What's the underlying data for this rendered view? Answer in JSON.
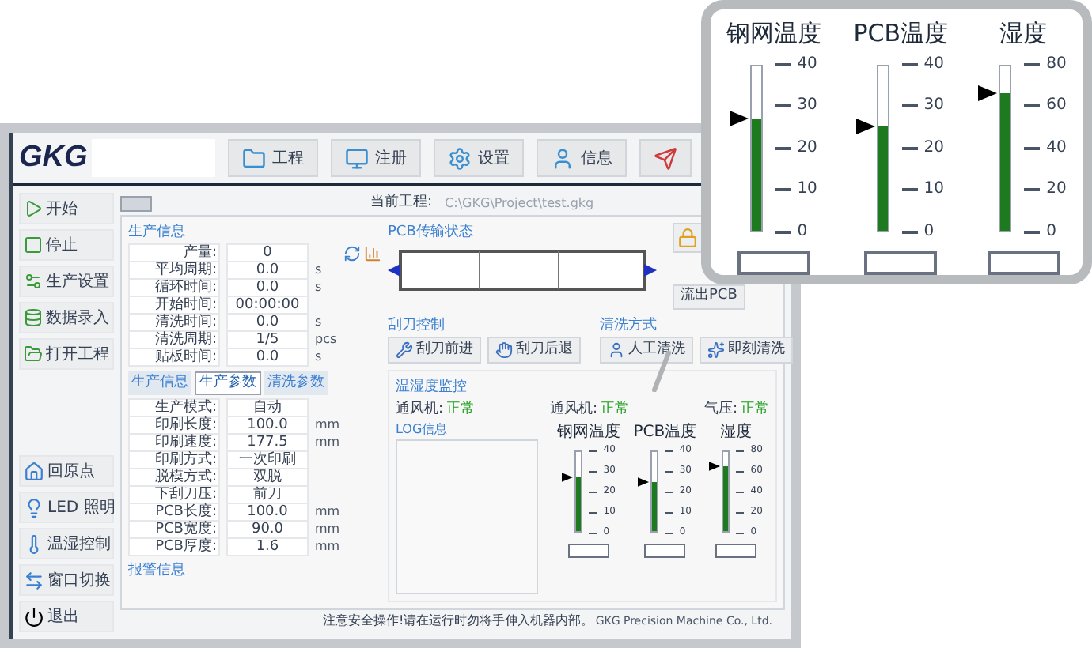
{
  "toolbar": {
    "logo": "GKG",
    "buttons": [
      {
        "label": "工程"
      },
      {
        "label": "注册"
      },
      {
        "label": "设置"
      },
      {
        "label": "信息"
      }
    ]
  },
  "sidebar": {
    "top_items": [
      {
        "label": "开始"
      },
      {
        "label": "停止"
      },
      {
        "label": "生产设置"
      },
      {
        "label": "数据录入"
      },
      {
        "label": "打开工程"
      }
    ],
    "bottom_items": [
      {
        "label": "回原点"
      },
      {
        "label": "LED 照明"
      },
      {
        "label": "温湿控制"
      },
      {
        "label": "窗口切换"
      },
      {
        "label": "退出"
      }
    ]
  },
  "current_project": {
    "label": "当前工程:",
    "value": "C:\\GKG\\Project\\test.gkg"
  },
  "production_info": {
    "title": "生产信息",
    "rows": [
      {
        "label": "产量:",
        "value": "0"
      },
      {
        "label": "平均周期:",
        "value": "0.0",
        "unit": "s"
      },
      {
        "label": "循环时间:",
        "value": "0.0",
        "unit": "s"
      },
      {
        "label": "开始时间:",
        "value": "00:00:00"
      },
      {
        "label": "清洗时间:",
        "value": "0.0",
        "unit": "s"
      },
      {
        "label": "清洗周期:",
        "value": "1/5",
        "unit": "pcs"
      },
      {
        "label": "贴板时间:",
        "value": "0.0",
        "unit": "s"
      }
    ]
  },
  "param_tabs": [
    {
      "label": "生产信息",
      "selected": false
    },
    {
      "label": "生产参数",
      "selected": true
    },
    {
      "label": "清洗参数",
      "selected": false
    }
  ],
  "params": [
    {
      "label": "生产模式:",
      "value": "自动"
    },
    {
      "label": "印刷长度:",
      "value": "100.0",
      "unit": "mm"
    },
    {
      "label": "印刷速度:",
      "value": "177.5",
      "unit": "mm"
    },
    {
      "label": "印刷方式:",
      "value": "一次印刷"
    },
    {
      "label": "脱模方式:",
      "value": "双脱"
    },
    {
      "label": "下刮刀压:",
      "value": "前刀"
    },
    {
      "label": "PCB长度:",
      "value": "100.0",
      "unit": "mm"
    },
    {
      "label": "PCB宽度:",
      "value": "90.0",
      "unit": "mm"
    },
    {
      "label": "PCB厚度:",
      "value": "1.6",
      "unit": "mm"
    }
  ],
  "alarm": {
    "title": "报警信息"
  },
  "conveyor": {
    "title": "PCB传输状态"
  },
  "side_button": {
    "label": "流出PCB"
  },
  "squeegee": {
    "title": "刮刀控制",
    "buttons": [
      "刮刀前进",
      "刮刀后退"
    ]
  },
  "cleaning": {
    "title": "清洗方式",
    "buttons": [
      "人工清洗",
      "即刻清洗"
    ]
  },
  "monitor": {
    "title": "温湿度监控",
    "statuses": [
      {
        "label": "通风机:",
        "value": "正常"
      },
      {
        "label": "通风机:",
        "value": "正常"
      },
      {
        "label": "气压:",
        "value": "正常"
      }
    ],
    "log_title": "LOG信息",
    "gauges": [
      {
        "label": "钢网温度",
        "ticks": [
          "40",
          "30",
          "20",
          "10",
          "0"
        ],
        "level": 0.68
      },
      {
        "label": "PCB温度",
        "ticks": [
          "40",
          "30",
          "20",
          "10",
          "0"
        ],
        "level": 0.63
      },
      {
        "label": "湿度",
        "ticks": [
          "80",
          "60",
          "40",
          "20",
          "0"
        ],
        "level": 0.83
      }
    ]
  },
  "status_bar": {
    "message": "注意安全操作!请在运行时勿将手伸入机器内部。",
    "company": "GKG Precision Machine Co., Ltd."
  },
  "magnifier": {
    "gauges": [
      {
        "label": "钢网温度",
        "ticks": [
          "40",
          "30",
          "20",
          "10",
          "0"
        ],
        "level": 0.68
      },
      {
        "label": "PCB温度",
        "ticks": [
          "40",
          "30",
          "20",
          "10",
          "0"
        ],
        "level": 0.63
      },
      {
        "label": "湿度",
        "ticks": [
          "80",
          "60",
          "40",
          "20",
          "0"
        ],
        "level": 0.83
      }
    ]
  }
}
